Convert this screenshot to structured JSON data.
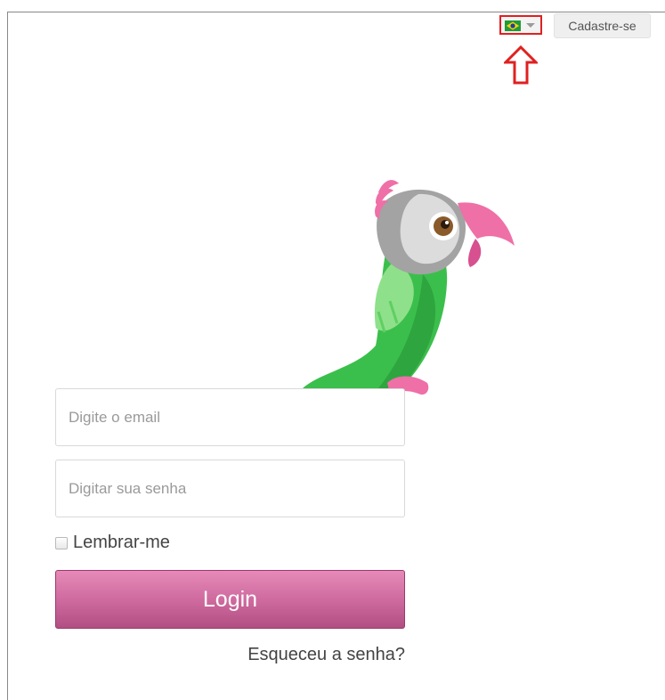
{
  "header": {
    "language_icon": "brazil-flag-icon",
    "signup_label": "Cadastre-se"
  },
  "login_form": {
    "email_placeholder": "Digite o email",
    "password_placeholder": "Digitar sua senha",
    "remember_label": "Lembrar-me",
    "login_label": "Login",
    "forgot_label": "Esqueceu a senha?"
  },
  "colors": {
    "login_button": "#cf6b9f",
    "annotation": "#e02020",
    "parrot_green": "#3bbf4c",
    "parrot_pink": "#ef6fa7"
  }
}
